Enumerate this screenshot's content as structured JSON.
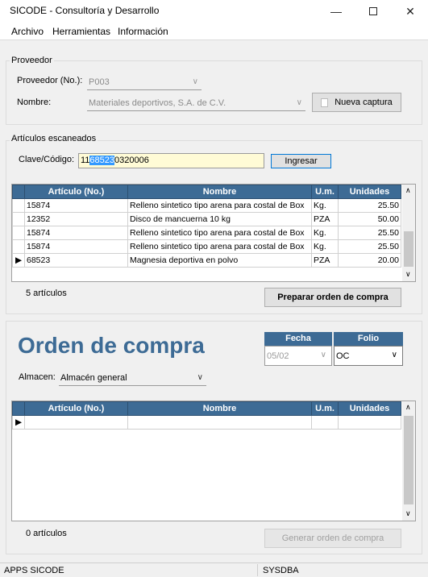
{
  "window": {
    "title": "SICODE - Consultoría y Desarrollo"
  },
  "menu": [
    "Archivo",
    "Herramientas",
    "Información"
  ],
  "proveedor": {
    "group_label": "Proveedor",
    "no_label": "Proveedor (No.):",
    "no_value": "P003",
    "nombre_label": "Nombre:",
    "nombre_value": "Materiales deportivos, S.A. de C.V.",
    "nueva_captura": "Nueva captura"
  },
  "escaneados": {
    "group_label": "Artículos escaneados",
    "clave_label": "Clave/Código:",
    "clave_prefix": "11",
    "clave_selected": "68523",
    "clave_suffix": "0320006",
    "ingresar": "Ingresar",
    "columns": [
      "Artículo (No.)",
      "Nombre",
      "U.m.",
      "Unidades"
    ],
    "rows": [
      {
        "articulo": "15874",
        "nombre": "Relleno sintetico tipo arena para costal de Box",
        "um": "Kg.",
        "unidades": "25.50"
      },
      {
        "articulo": "12352",
        "nombre": "Disco de mancuerna 10 kg",
        "um": "PZA",
        "unidades": "50.00"
      },
      {
        "articulo": "15874",
        "nombre": "Relleno sintetico tipo arena para costal de Box",
        "um": "Kg.",
        "unidades": "25.50"
      },
      {
        "articulo": "15874",
        "nombre": "Relleno sintetico tipo arena para costal de Box",
        "um": "Kg.",
        "unidades": "25.50"
      },
      {
        "articulo": "68523",
        "nombre": "Magnesia deportiva en polvo",
        "um": "PZA",
        "unidades": "20.00"
      }
    ],
    "count": "5 artículos",
    "preparar": "Preparar orden de compra"
  },
  "orden": {
    "title": "Orden de compra",
    "fecha_label": "Fecha",
    "fecha_value": "05/02",
    "folio_label": "Folio",
    "folio_value": "OC",
    "almacen_label": "Almacen:",
    "almacen_value": "Almacén general",
    "columns": [
      "Artículo (No.)",
      "Nombre",
      "U.m.",
      "Unidades"
    ],
    "count": "0 artículos",
    "generar": "Generar orden de compra"
  },
  "status": {
    "app": "APPS SICODE",
    "user": "SYSDBA"
  }
}
